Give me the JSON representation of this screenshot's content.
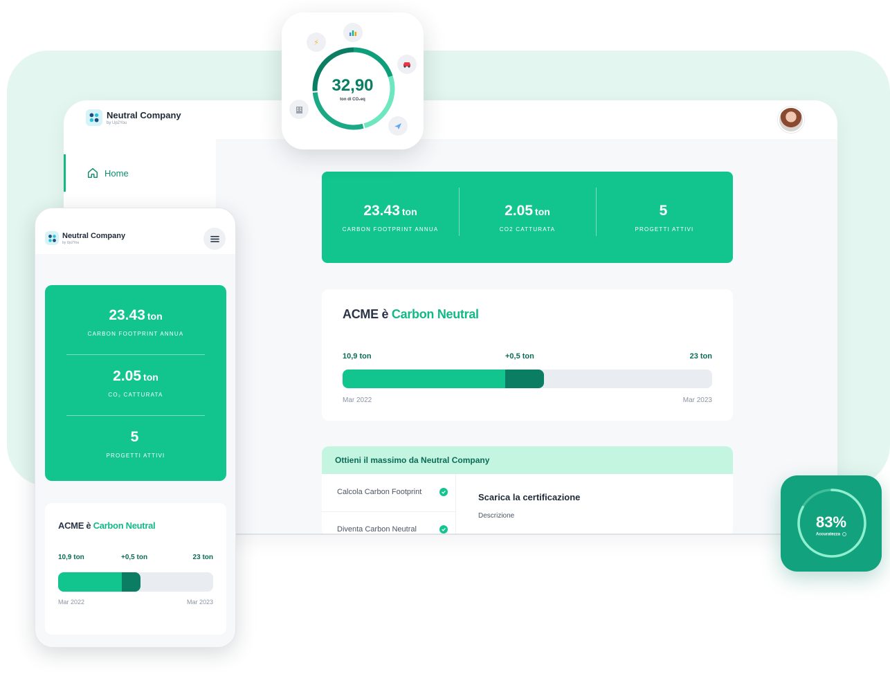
{
  "brand": {
    "name": "Neutral Company",
    "sub": "by Up2You"
  },
  "desktop": {
    "nav": {
      "home": "Home"
    },
    "stats": [
      {
        "value": "23.43",
        "unit": "ton",
        "label": "CARBON FOOTPRINT ANNUA"
      },
      {
        "value": "2.05",
        "unit": "ton",
        "label": "CO2 CATTURATA"
      },
      {
        "value": "5",
        "unit": "",
        "label": "PROGETTI ATTIVI"
      }
    ],
    "neutral": {
      "title_prefix": "ACME è",
      "title_accent": "Carbon Neutral",
      "start_value": "10,9 ton",
      "delta_value": "+0,5 ton",
      "end_value": "23 ton",
      "start_date": "Mar 2022",
      "end_date": "Mar 2023",
      "progress_fraction": 0.44,
      "delta_fraction": 0.105
    },
    "onboarding": {
      "title": "Ottieni il massimo da Neutral Company",
      "steps": [
        "Calcola Carbon Footprint",
        "Diventa Carbon Neutral"
      ],
      "detail_title": "Scarica la certificazione",
      "detail_desc": "Descrizione"
    }
  },
  "donut": {
    "value": "32,90",
    "unit": "ton di CO₂eq",
    "icons": [
      "lightning-icon",
      "chart-icon",
      "car-icon",
      "building-icon",
      "plane-icon"
    ]
  },
  "mobile": {
    "stats": [
      {
        "value": "23.43",
        "unit": "ton",
        "label": "CARBON FOOTPRINT ANNUA"
      },
      {
        "value": "2.05",
        "unit": "ton",
        "label": "CO₂ CATTURATA"
      },
      {
        "value": "5",
        "unit": "",
        "label": "PROGETTI ATTIVI"
      }
    ],
    "neutral": {
      "title_prefix": "ACME è",
      "title_accent": "Carbon Neutral",
      "start_value": "10,9 ton",
      "delta_value": "+0,5 ton",
      "end_value": "23 ton",
      "start_date": "Mar 2022",
      "end_date": "Mar 2023",
      "progress_fraction": 0.41,
      "delta_fraction": 0.12
    }
  },
  "accuracy": {
    "value": "83%",
    "label": "Accuratezza",
    "fraction": 0.83
  },
  "colors": {
    "accent": "#12c48e",
    "accent_dark": "#0b7d63",
    "mint_bg": "#e3f6ef",
    "banner": "#c3f5e1"
  }
}
